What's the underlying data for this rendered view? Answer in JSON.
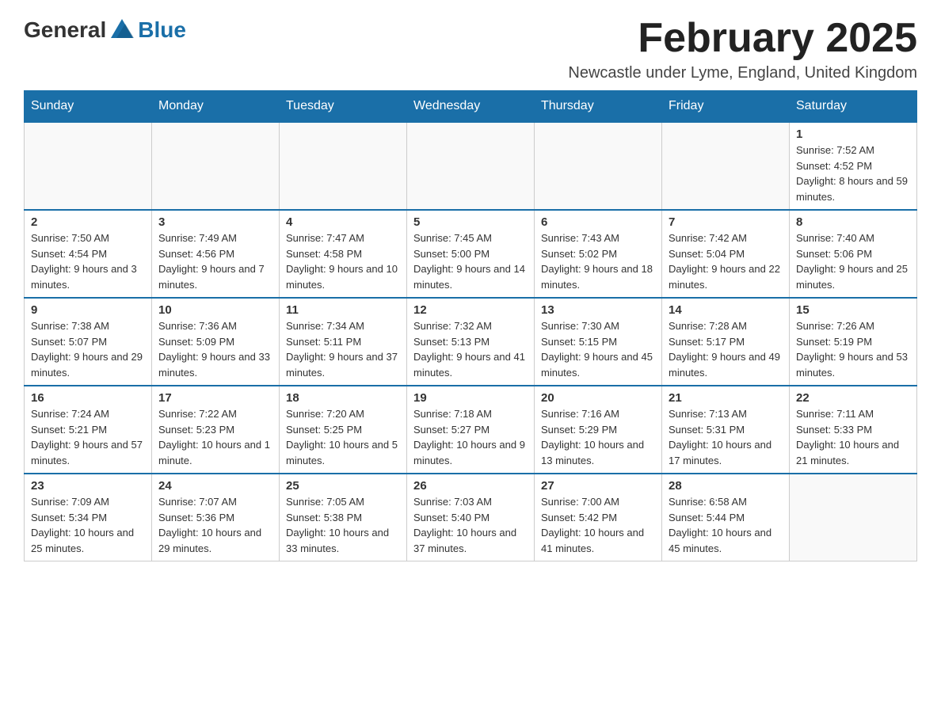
{
  "logo": {
    "general": "General",
    "blue": "Blue"
  },
  "title": "February 2025",
  "subtitle": "Newcastle under Lyme, England, United Kingdom",
  "days_of_week": [
    "Sunday",
    "Monday",
    "Tuesday",
    "Wednesday",
    "Thursday",
    "Friday",
    "Saturday"
  ],
  "weeks": [
    [
      {
        "day": "",
        "info": ""
      },
      {
        "day": "",
        "info": ""
      },
      {
        "day": "",
        "info": ""
      },
      {
        "day": "",
        "info": ""
      },
      {
        "day": "",
        "info": ""
      },
      {
        "day": "",
        "info": ""
      },
      {
        "day": "1",
        "info": "Sunrise: 7:52 AM\nSunset: 4:52 PM\nDaylight: 8 hours and 59 minutes."
      }
    ],
    [
      {
        "day": "2",
        "info": "Sunrise: 7:50 AM\nSunset: 4:54 PM\nDaylight: 9 hours and 3 minutes."
      },
      {
        "day": "3",
        "info": "Sunrise: 7:49 AM\nSunset: 4:56 PM\nDaylight: 9 hours and 7 minutes."
      },
      {
        "day": "4",
        "info": "Sunrise: 7:47 AM\nSunset: 4:58 PM\nDaylight: 9 hours and 10 minutes."
      },
      {
        "day": "5",
        "info": "Sunrise: 7:45 AM\nSunset: 5:00 PM\nDaylight: 9 hours and 14 minutes."
      },
      {
        "day": "6",
        "info": "Sunrise: 7:43 AM\nSunset: 5:02 PM\nDaylight: 9 hours and 18 minutes."
      },
      {
        "day": "7",
        "info": "Sunrise: 7:42 AM\nSunset: 5:04 PM\nDaylight: 9 hours and 22 minutes."
      },
      {
        "day": "8",
        "info": "Sunrise: 7:40 AM\nSunset: 5:06 PM\nDaylight: 9 hours and 25 minutes."
      }
    ],
    [
      {
        "day": "9",
        "info": "Sunrise: 7:38 AM\nSunset: 5:07 PM\nDaylight: 9 hours and 29 minutes."
      },
      {
        "day": "10",
        "info": "Sunrise: 7:36 AM\nSunset: 5:09 PM\nDaylight: 9 hours and 33 minutes."
      },
      {
        "day": "11",
        "info": "Sunrise: 7:34 AM\nSunset: 5:11 PM\nDaylight: 9 hours and 37 minutes."
      },
      {
        "day": "12",
        "info": "Sunrise: 7:32 AM\nSunset: 5:13 PM\nDaylight: 9 hours and 41 minutes."
      },
      {
        "day": "13",
        "info": "Sunrise: 7:30 AM\nSunset: 5:15 PM\nDaylight: 9 hours and 45 minutes."
      },
      {
        "day": "14",
        "info": "Sunrise: 7:28 AM\nSunset: 5:17 PM\nDaylight: 9 hours and 49 minutes."
      },
      {
        "day": "15",
        "info": "Sunrise: 7:26 AM\nSunset: 5:19 PM\nDaylight: 9 hours and 53 minutes."
      }
    ],
    [
      {
        "day": "16",
        "info": "Sunrise: 7:24 AM\nSunset: 5:21 PM\nDaylight: 9 hours and 57 minutes."
      },
      {
        "day": "17",
        "info": "Sunrise: 7:22 AM\nSunset: 5:23 PM\nDaylight: 10 hours and 1 minute."
      },
      {
        "day": "18",
        "info": "Sunrise: 7:20 AM\nSunset: 5:25 PM\nDaylight: 10 hours and 5 minutes."
      },
      {
        "day": "19",
        "info": "Sunrise: 7:18 AM\nSunset: 5:27 PM\nDaylight: 10 hours and 9 minutes."
      },
      {
        "day": "20",
        "info": "Sunrise: 7:16 AM\nSunset: 5:29 PM\nDaylight: 10 hours and 13 minutes."
      },
      {
        "day": "21",
        "info": "Sunrise: 7:13 AM\nSunset: 5:31 PM\nDaylight: 10 hours and 17 minutes."
      },
      {
        "day": "22",
        "info": "Sunrise: 7:11 AM\nSunset: 5:33 PM\nDaylight: 10 hours and 21 minutes."
      }
    ],
    [
      {
        "day": "23",
        "info": "Sunrise: 7:09 AM\nSunset: 5:34 PM\nDaylight: 10 hours and 25 minutes."
      },
      {
        "day": "24",
        "info": "Sunrise: 7:07 AM\nSunset: 5:36 PM\nDaylight: 10 hours and 29 minutes."
      },
      {
        "day": "25",
        "info": "Sunrise: 7:05 AM\nSunset: 5:38 PM\nDaylight: 10 hours and 33 minutes."
      },
      {
        "day": "26",
        "info": "Sunrise: 7:03 AM\nSunset: 5:40 PM\nDaylight: 10 hours and 37 minutes."
      },
      {
        "day": "27",
        "info": "Sunrise: 7:00 AM\nSunset: 5:42 PM\nDaylight: 10 hours and 41 minutes."
      },
      {
        "day": "28",
        "info": "Sunrise: 6:58 AM\nSunset: 5:44 PM\nDaylight: 10 hours and 45 minutes."
      },
      {
        "day": "",
        "info": ""
      }
    ]
  ]
}
